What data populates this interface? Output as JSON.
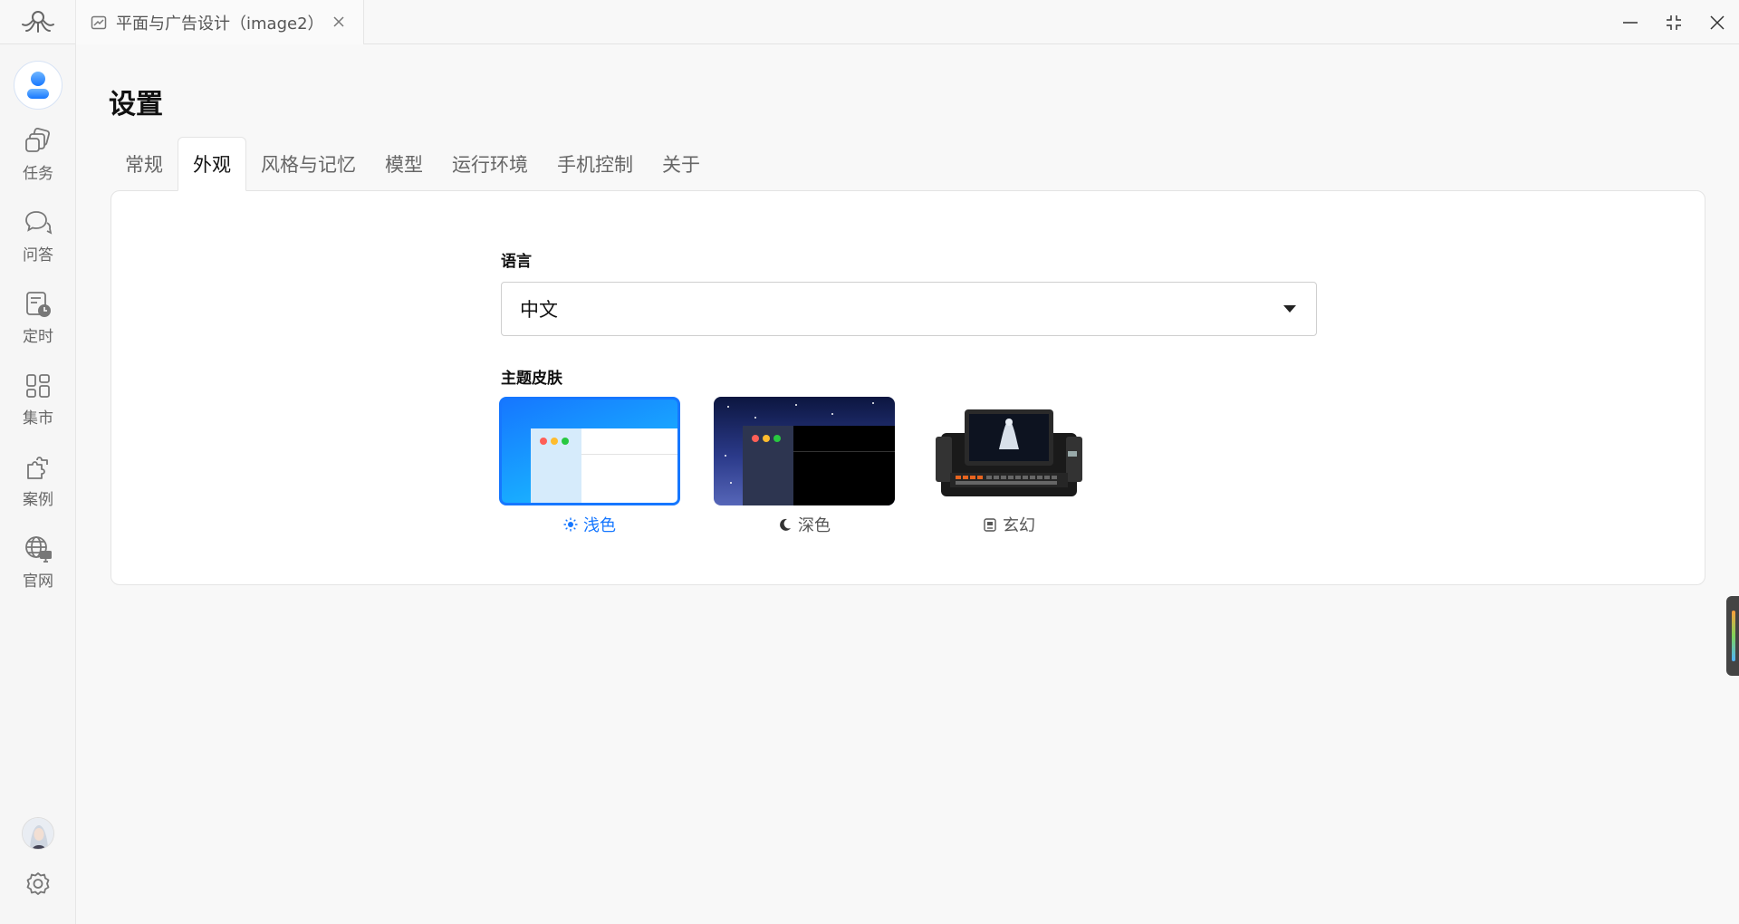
{
  "titlebar": {
    "tab_title": "平面与广告设计（image2）",
    "icons": {
      "logo": "octopus-logo-icon",
      "tab": "image-icon",
      "close": "close-icon",
      "minimize": "minimize-icon",
      "restore": "restore-icon",
      "window_close": "close-icon"
    }
  },
  "sidebar": {
    "items": [
      {
        "label": "任务",
        "icon": "task-stack-icon"
      },
      {
        "label": "问答",
        "icon": "chat-bubble-icon"
      },
      {
        "label": "定时",
        "icon": "scheduled-clock-icon"
      },
      {
        "label": "集市",
        "icon": "market-grid-icon"
      },
      {
        "label": "案例",
        "icon": "puzzle-icon"
      },
      {
        "label": "官网",
        "icon": "globe-icon"
      }
    ]
  },
  "settings": {
    "title": "设置",
    "tabs": [
      "常规",
      "外观",
      "风格与记忆",
      "模型",
      "运行环境",
      "手机控制",
      "关于"
    ],
    "active_tab": "外观",
    "language": {
      "label": "语言",
      "value": "中文"
    },
    "theme": {
      "label": "主题皮肤",
      "options": [
        {
          "label": "浅色",
          "icon": "sun-icon",
          "selected": true
        },
        {
          "label": "深色",
          "icon": "moon-icon",
          "selected": false
        },
        {
          "label": "玄幻",
          "icon": "robot-icon",
          "selected": false
        }
      ]
    }
  },
  "colors": {
    "accent": "#1677ff",
    "background": "#f8f8f8"
  }
}
